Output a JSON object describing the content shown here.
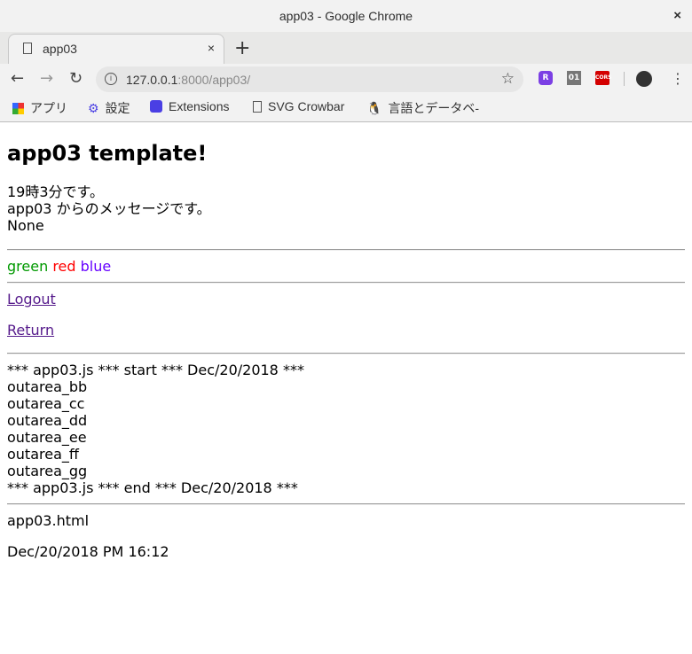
{
  "window": {
    "title": "app03 - Google Chrome",
    "close": "×"
  },
  "tab": {
    "title": "app03",
    "close": "×",
    "new": "+"
  },
  "address": {
    "host": "127.0.0.1",
    "rest": ":8000/app03/"
  },
  "extensions": [
    {
      "label": "R",
      "color": "#7b3fe4"
    },
    {
      "label": "01",
      "color": "#777777"
    },
    {
      "label": "CORS",
      "color": "#d40000"
    }
  ],
  "bookmarks": [
    {
      "label": "アプリ",
      "icon": "apps-grid-icon"
    },
    {
      "label": "設定",
      "icon": "gear-icon"
    },
    {
      "label": "Extensions",
      "icon": "puzzle-icon"
    },
    {
      "label": "SVG Crowbar",
      "icon": "document-icon"
    },
    {
      "label": "言語とデータベ-",
      "icon": "penguin-icon"
    }
  ],
  "page": {
    "heading": "app03 template!",
    "lines": [
      "19時3分です。",
      "app03 からのメッセージです。",
      "None"
    ],
    "colors": [
      {
        "text": "green",
        "color": "#009900"
      },
      {
        "text": "red",
        "color": "#ff0000"
      },
      {
        "text": "blue",
        "color": "#6600ff"
      }
    ],
    "links": {
      "logout": "Logout",
      "return": "Return"
    },
    "output": [
      "*** app03.js *** start *** Dec/20/2018 ***",
      "outarea_bb",
      "outarea_cc",
      "outarea_dd",
      "outarea_ee",
      "outarea_ff",
      "outarea_gg",
      "*** app03.js *** end *** Dec/20/2018 ***"
    ],
    "filename": "app03.html",
    "datetime": "Dec/20/2018 PM 16:12"
  }
}
